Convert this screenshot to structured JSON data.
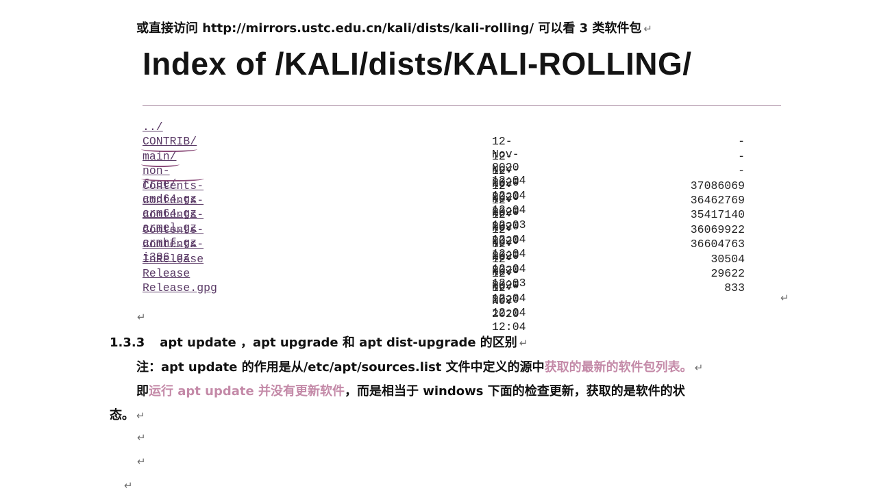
{
  "intro": {
    "text": "或直接访问  http://mirrors.ustc.edu.cn/kali/dists/kali-rolling/  可以看 3 类软件包"
  },
  "index_title": "Index of /KALI/dists/KALI-ROLLING/",
  "listing": {
    "rows": [
      {
        "name": "../",
        "date": "",
        "size": ""
      },
      {
        "name": "CONTRIB/",
        "date": "12-Nov-2020 12:04",
        "size": "-"
      },
      {
        "name": "main/",
        "date": "12-Nov-2020 12:04",
        "size": "-"
      },
      {
        "name": "non-free/",
        "date": "12-Nov-2020 12:04",
        "size": "-"
      },
      {
        "name": "Contents-amd64.gz",
        "date": "12-Nov-2020 12:03",
        "size": "37086069"
      },
      {
        "name": "Contents-arm64.gz",
        "date": "12-Nov-2020 12:04",
        "size": "36462769"
      },
      {
        "name": "Contents-armel.gz",
        "date": "12-Nov-2020 12:04",
        "size": "35417140"
      },
      {
        "name": "Contents-armhf.gz",
        "date": "12-Nov-2020 12:04",
        "size": "36069922"
      },
      {
        "name": "Contents-i386.gz",
        "date": "12-Nov-2020 12:03",
        "size": "36604763"
      },
      {
        "name": "InRelease",
        "date": "12-Nov-2020 12:04",
        "size": "30504"
      },
      {
        "name": "Release",
        "date": "12-Nov-2020 12:04",
        "size": "29622"
      },
      {
        "name": "Release.gpg",
        "date": "12-Nov-2020 12:04",
        "size": "833"
      }
    ]
  },
  "section": {
    "number": "1.3.3",
    "title": "apt update  ，apt upgrade  和 apt dist-upgrade  的区别"
  },
  "note": {
    "prefix": "注：apt update  的作用是从/etc/apt/sources.list 文件中定义的源中",
    "highlight": "获取的最新的软件包列表。"
  },
  "para2": {
    "prefix": "即",
    "highlight": "运行 apt update 并没有更新软件",
    "rest": "，而是相当于 windows 下面的检查更新，获取的是软件的状",
    "line2": "态。"
  },
  "colors": {
    "highlight": "#c48aa8",
    "link": "#5a3a66",
    "squiggle": "#8a4a78"
  }
}
